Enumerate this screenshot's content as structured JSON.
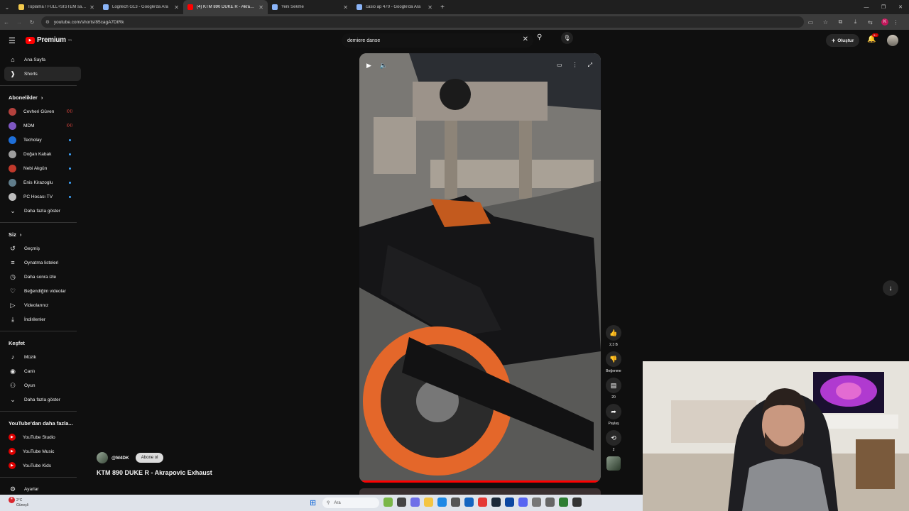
{
  "browser": {
    "tabs": [
      {
        "title": "Toplama / FULL+SİSTEM sahibi...",
        "color": "#f2c94c"
      },
      {
        "title": "Logitech G13 - Google'da Ara",
        "color": "#8ab4f8"
      },
      {
        "title": "(4) KTM 890 DUKE R - Akrapovic...",
        "color": "#ff0000"
      },
      {
        "title": "Yeni Sekme",
        "color": "#8ab4f8"
      },
      {
        "title": "casio ap 470 - Google'da Ara",
        "color": "#8ab4f8"
      }
    ],
    "url": "youtube.com/shorts/85cagA7DtRk",
    "profile_initial": "K"
  },
  "header": {
    "logo_text": "Premium",
    "logo_sup": "TR",
    "search_value": "demiere danse",
    "create_label": "Oluştur",
    "notification_count": "9+"
  },
  "sidebar": {
    "main": [
      {
        "label": "Ana Sayfa",
        "icon": "home-icon",
        "glyph": "⌂"
      },
      {
        "label": "Shorts",
        "icon": "shorts-icon",
        "glyph": "❱"
      }
    ],
    "subs_title": "Abonelikler",
    "subs": [
      {
        "label": "Cevheri Güven",
        "color": "#b3413d",
        "badge": "live"
      },
      {
        "label": "MDM",
        "color": "#7e57c2",
        "badge": "live"
      },
      {
        "label": "Techolay",
        "color": "#1e6fd9",
        "badge": "dot"
      },
      {
        "label": "Doğan Kabak",
        "color": "#9e9e9e",
        "badge": "dot"
      },
      {
        "label": "Nebi Akgün",
        "color": "#c0392b",
        "badge": "dot"
      },
      {
        "label": "Enis Kirazoglu",
        "color": "#607d8b",
        "badge": "dot"
      },
      {
        "label": "PC Hocası TV",
        "color": "#bdbdbd",
        "badge": "dot"
      }
    ],
    "subs_more": "Daha fazla göster",
    "you_title": "Siz",
    "you": [
      {
        "label": "Geçmiş",
        "icon": "history-icon",
        "glyph": "↺"
      },
      {
        "label": "Oynatma listeleri",
        "icon": "playlist-icon",
        "glyph": "≡"
      },
      {
        "label": "Daha sonra izle",
        "icon": "clock-icon",
        "glyph": "◷"
      },
      {
        "label": "Beğendiğim videolar",
        "icon": "like-icon",
        "glyph": "♡"
      },
      {
        "label": "Videolarınız",
        "icon": "video-icon",
        "glyph": "▷"
      },
      {
        "label": "İndirilenler",
        "icon": "download-icon",
        "glyph": "⤓"
      }
    ],
    "explore_title": "Keşfet",
    "explore": [
      {
        "label": "Müzik",
        "icon": "music-icon",
        "glyph": "♪"
      },
      {
        "label": "Canlı",
        "icon": "live-icon",
        "glyph": "◉"
      },
      {
        "label": "Oyun",
        "icon": "gaming-icon",
        "glyph": "⚇"
      }
    ],
    "explore_more": "Daha fazla göster",
    "more_title": "YouTube'dan daha fazla...",
    "more": [
      {
        "label": "YouTube Studio"
      },
      {
        "label": "YouTube Music"
      },
      {
        "label": "YouTube Kids"
      }
    ],
    "settings": "Ayarlar"
  },
  "short": {
    "channel": "@M4DK",
    "subscribe": "Abone ol",
    "title": "KTM 890 DUKE R - Akrapovic Exhaust",
    "like_count": "2,3 B",
    "dislike_label": "Beğenme",
    "comment_count": "20",
    "share_label": "Paylaş",
    "remix_count": "2",
    "progress": 1.0
  },
  "taskbar": {
    "weather_temp": "2°C",
    "weather_text": "Güneşli",
    "search_placeholder": "Ara"
  }
}
